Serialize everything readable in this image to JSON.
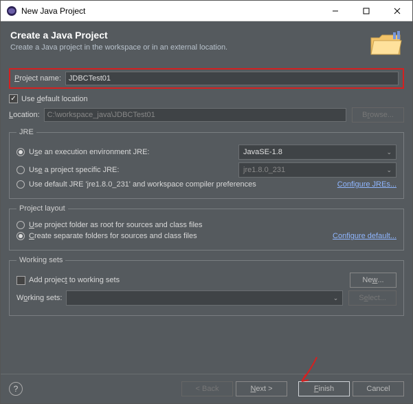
{
  "titlebar": {
    "title": "New Java Project"
  },
  "header": {
    "title": "Create a Java Project",
    "subtitle": "Create a Java project in the workspace or in an external location."
  },
  "project": {
    "name_label": "Project name:",
    "name_value": "JDBCTest01"
  },
  "location": {
    "use_default_label": "Use default location",
    "use_default_checked": true,
    "label": "Location:",
    "value": "C:\\workspace_java\\JDBCTest01",
    "browse_label": "Browse..."
  },
  "jre": {
    "legend": "JRE",
    "opt1_label": "Use an execution environment JRE:",
    "opt1_value": "JavaSE-1.8",
    "opt2_label": "Use a project specific JRE:",
    "opt2_value": "jre1.8.0_231",
    "opt3_label": "Use default JRE 'jre1.8.0_231' and workspace compiler preferences",
    "configure_link": "Configure JREs..."
  },
  "layout": {
    "legend": "Project layout",
    "opt1_label": "Use project folder as root for sources and class files",
    "opt2_label": "Create separate folders for sources and class files",
    "configure_link": "Configure default..."
  },
  "working": {
    "legend": "Working sets",
    "add_label": "Add project to working sets",
    "new_label": "New...",
    "sets_label": "Working sets:",
    "select_label": "Select..."
  },
  "footer": {
    "back": "< Back",
    "next": "Next >",
    "finish": "Finish",
    "cancel": "Cancel"
  }
}
